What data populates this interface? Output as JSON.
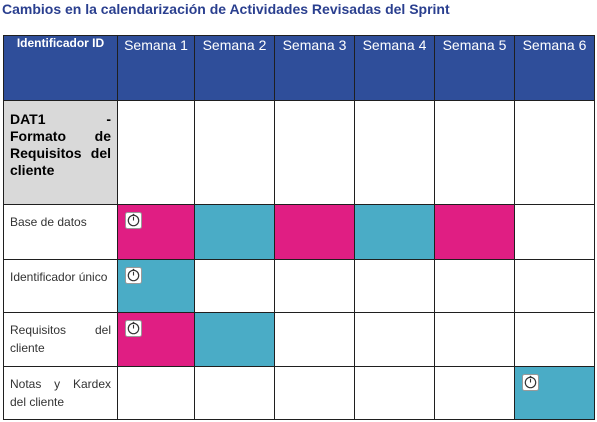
{
  "title": "Cambios en la calendarización de Actividades Revisadas del Sprint",
  "header": {
    "id_label": "Identificador ID",
    "weeks": [
      "Semana 1",
      "Semana 2",
      "Semana 3",
      "Semana 4",
      "Semana 5",
      "Semana 6"
    ]
  },
  "section": {
    "label": "DAT1 - Formato de Requisitos del cliente"
  },
  "colors": {
    "header_bg": "#2f4e9a",
    "title": "#2a3f8f",
    "section_bg": "#d9d9d9",
    "pink": "#e01e83",
    "teal": "#4aacc6"
  },
  "rows": [
    {
      "label": "Base de datos",
      "cells": [
        "pink",
        "teal",
        "pink",
        "teal",
        "pink",
        ""
      ],
      "clock_week": 1
    },
    {
      "label": "Identificador único",
      "cells": [
        "teal",
        "",
        "",
        "",
        "",
        ""
      ],
      "clock_week": 1
    },
    {
      "label": "Requisitos del cliente",
      "cells": [
        "pink",
        "teal",
        "",
        "",
        "",
        ""
      ],
      "clock_week": 1
    },
    {
      "label": "Notas y Kardex del cliente",
      "cells": [
        "",
        "",
        "",
        "",
        "",
        "teal"
      ],
      "clock_week": 6
    }
  ]
}
